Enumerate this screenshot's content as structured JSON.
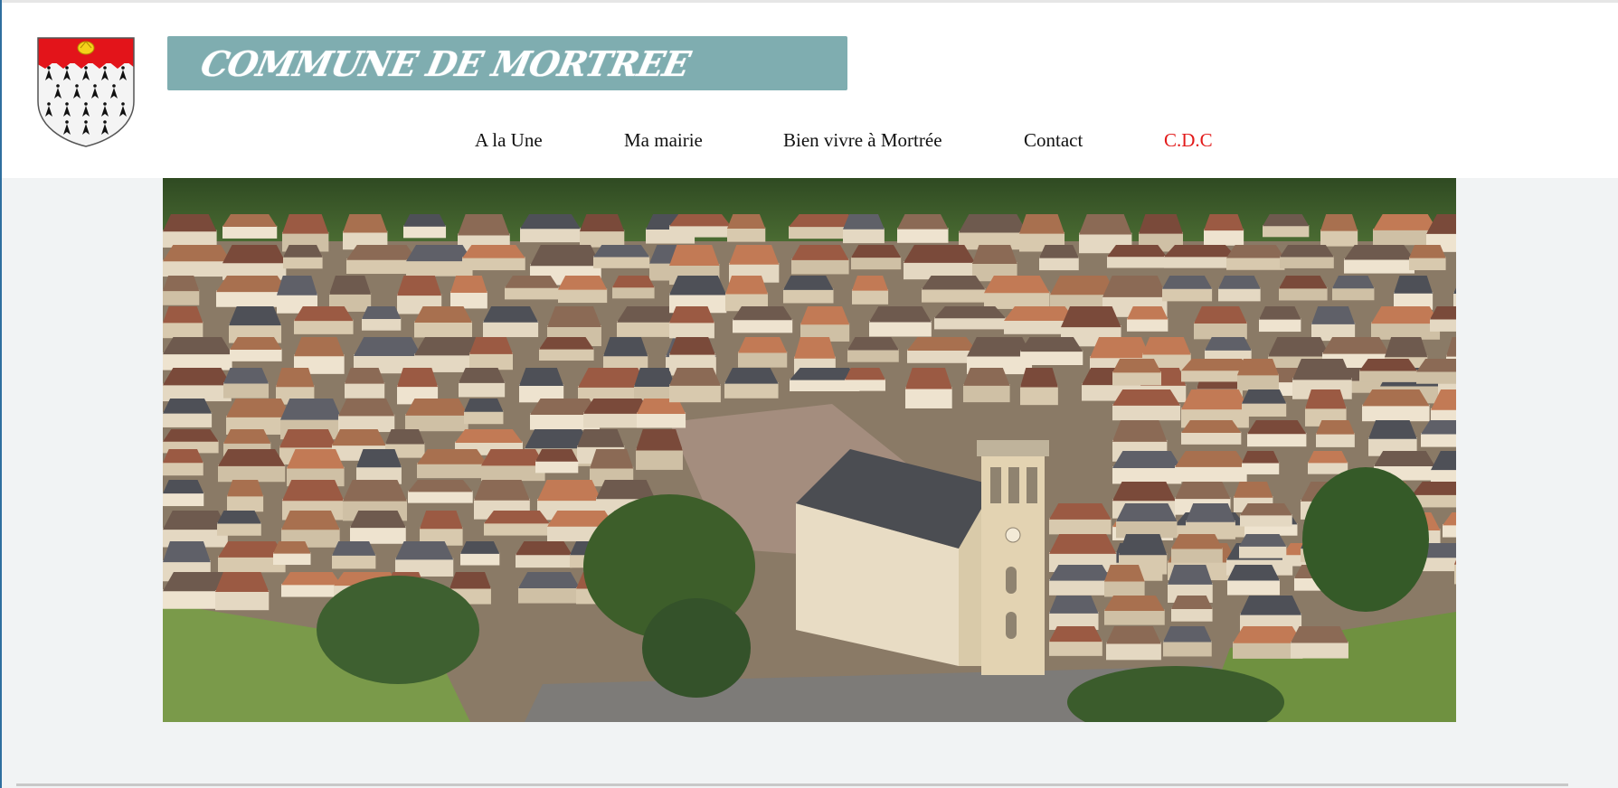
{
  "site": {
    "title": "COMMUNE DE MORTREE",
    "crest_icon": "coat-of-arms-ermine-icon"
  },
  "nav": {
    "items": [
      {
        "label": "A la Une",
        "active": false
      },
      {
        "label": "Ma mairie",
        "active": false
      },
      {
        "label": "Bien vivre à Mortrée",
        "active": false
      },
      {
        "label": "Contact",
        "active": false
      },
      {
        "label": "C.D.C",
        "active": true
      }
    ]
  },
  "hero": {
    "alt_icon": "aerial-village-photo"
  },
  "colors": {
    "title_bar": "#7fadb0",
    "nav_active": "#e21a1a",
    "page_bg": "#f1f3f4"
  }
}
